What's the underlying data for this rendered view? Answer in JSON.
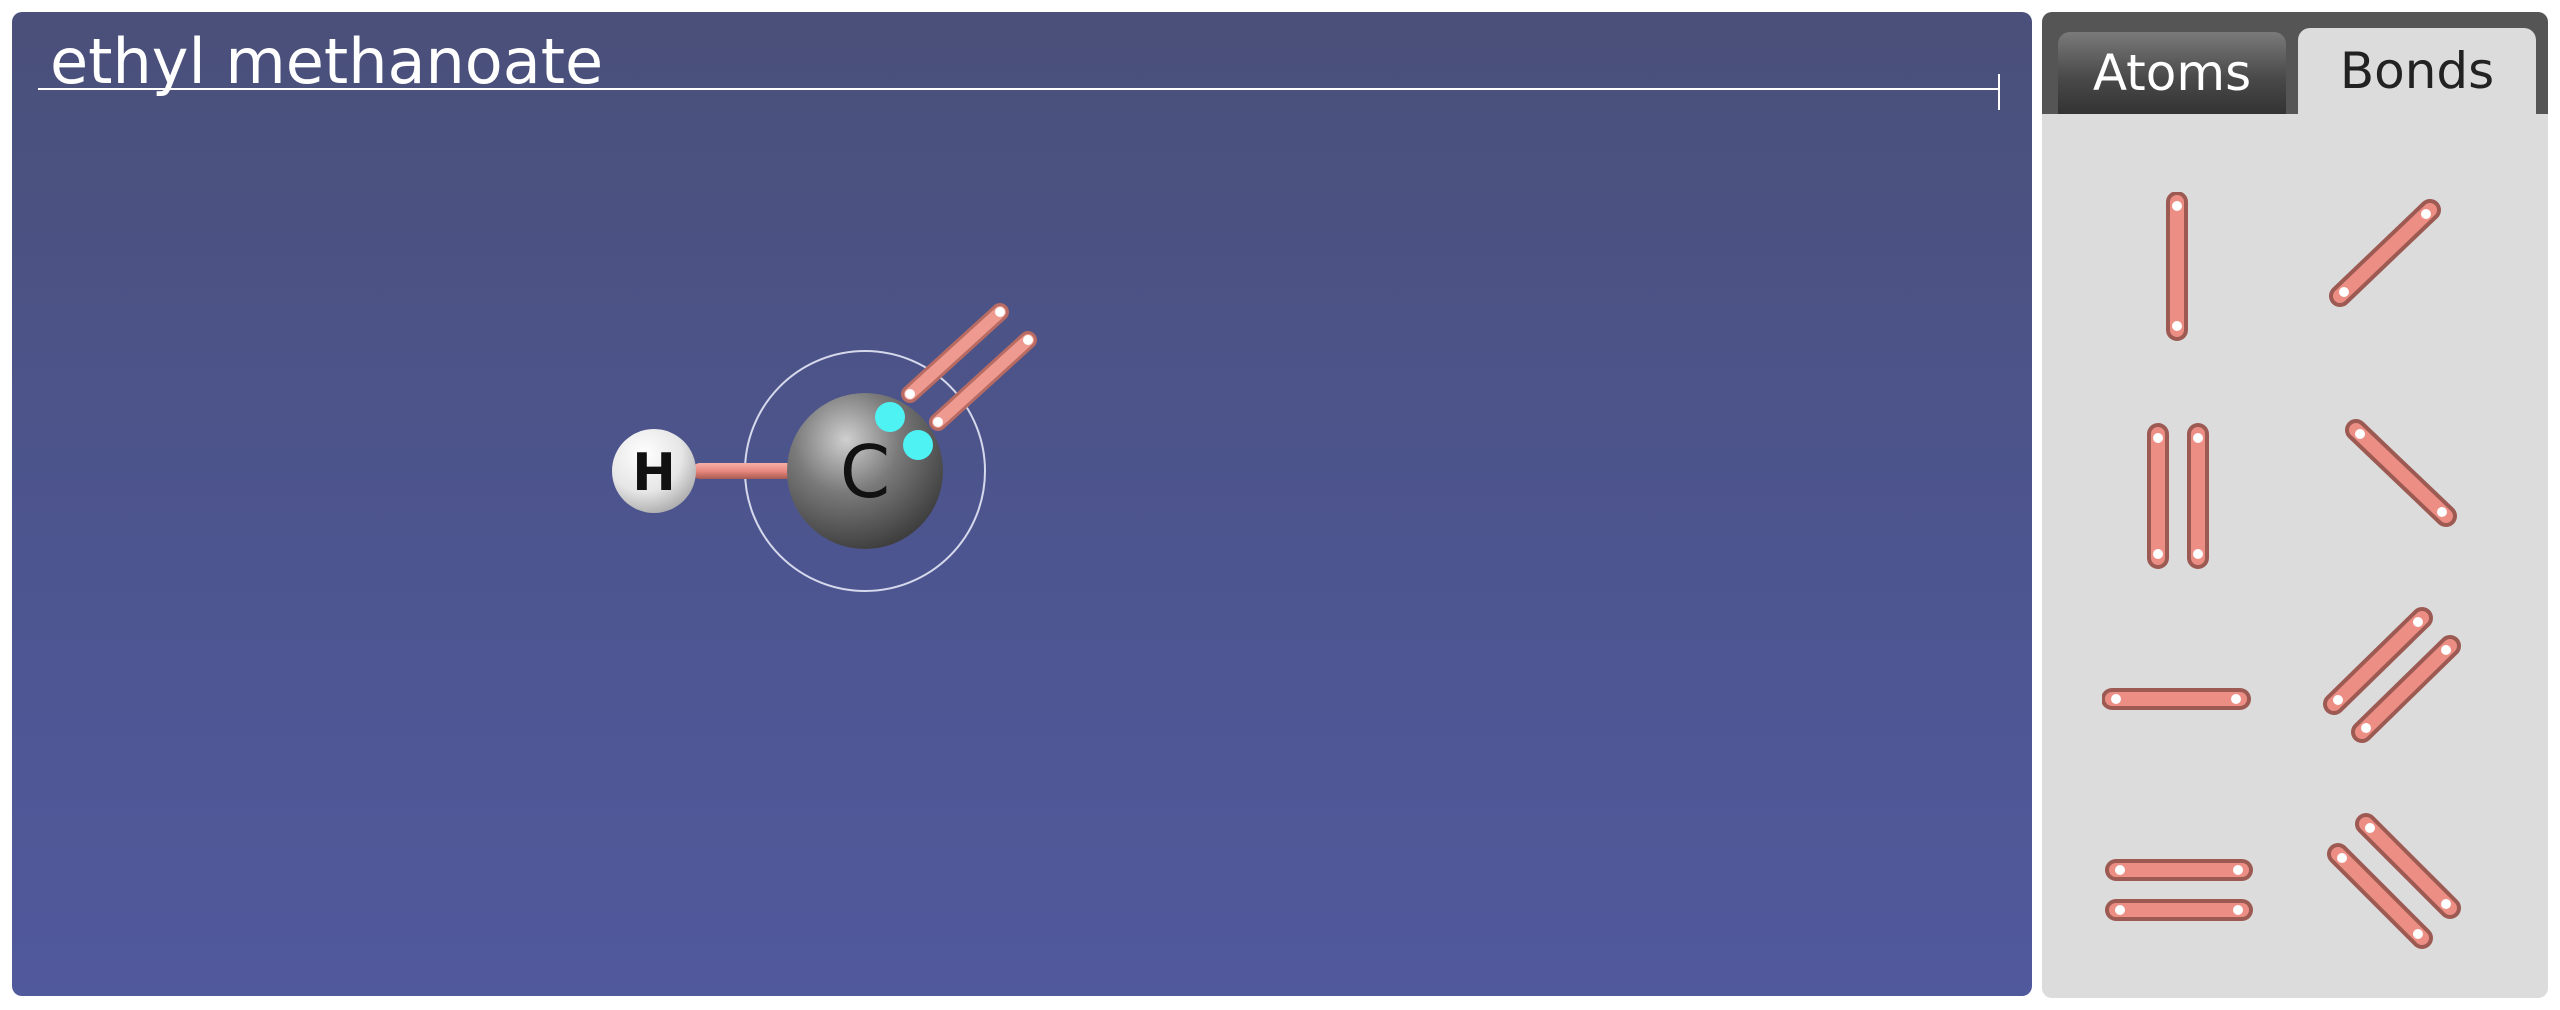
{
  "canvas": {
    "title": "ethyl methanoate"
  },
  "molecule": {
    "atoms": [
      {
        "symbol": "H",
        "color": "#f2f2f2"
      },
      {
        "symbol": "C",
        "color": "#6b6b6b"
      }
    ],
    "bond_color": "#e8897f",
    "open_site_color": "#4ef2f2"
  },
  "panel": {
    "tabs": [
      {
        "label": "Atoms",
        "active": false
      },
      {
        "label": "Bonds",
        "active": true
      }
    ],
    "palette_items": [
      "single-vertical-bond",
      "single-diagonal-up-bond",
      "double-vertical-bond",
      "single-diagonal-down-bond",
      "single-horizontal-bond",
      "double-diagonal-up-bond",
      "double-horizontal-bond",
      "double-diagonal-down-bond"
    ]
  }
}
